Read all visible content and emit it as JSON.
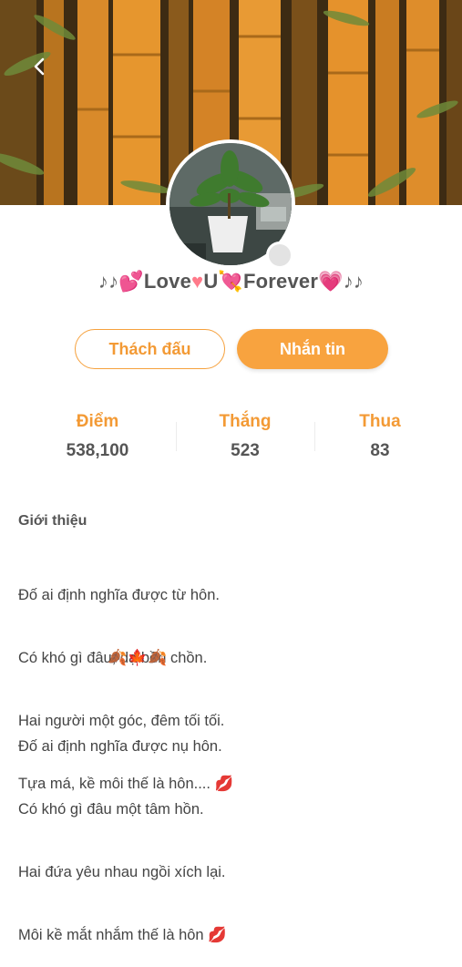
{
  "profile": {
    "name_parts": [
      "♪♪",
      "💕",
      "Love",
      "♥",
      "U",
      "💘",
      "Forever",
      "💗",
      "♪♪"
    ]
  },
  "actions": {
    "challenge_label": "Thách đấu",
    "message_label": "Nhắn tin"
  },
  "stats": [
    {
      "label": "Điểm",
      "value": "538,100"
    },
    {
      "label": "Thắng",
      "value": "523"
    },
    {
      "label": "Thua",
      "value": "83"
    }
  ],
  "intro": {
    "title": "Giới thiệu",
    "stanza1": [
      "Đố ai định nghĩa được từ hôn.",
      "Có khó gì đâu, dạ bồn chồn.",
      "Hai người một góc, đêm tối tối.",
      "Tựa má, kề môi thế là hôn.... 💋"
    ],
    "divider": "🍂🍁🍂",
    "stanza2": [
      "Đố ai định nghĩa được nụ hôn.",
      "Có khó gì đâu một tâm hồn.",
      "Hai đứa yêu nhau ngồi xích lại.",
      "Môi kề mắt nhắm thế là hôn 💋"
    ]
  },
  "colors": {
    "accent": "#f8a33f",
    "accent_text": "#f39a35"
  },
  "icons": {
    "back": "chevron-left-icon",
    "status": "status-dot-icon"
  }
}
